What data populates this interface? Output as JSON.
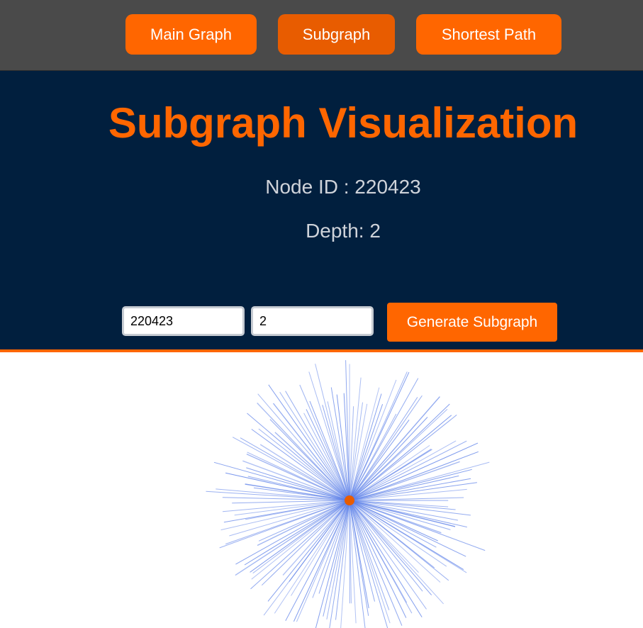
{
  "nav": {
    "main_label": "Main Graph",
    "subgraph_label": "Subgraph",
    "shortest_path_label": "Shortest Path"
  },
  "header": {
    "title": "Subgraph Visualization",
    "node_id_text": "Node ID : 220423",
    "depth_text": "Depth: 2"
  },
  "form": {
    "node_id_value": "220423",
    "depth_value": "2",
    "generate_label": "Generate Subgraph"
  },
  "graph": {
    "center_node_id": "220423",
    "edge_count": 150,
    "colors": {
      "edge": "#5b7fe8",
      "center_node": "#e85c00",
      "accent": "#ff6600",
      "header_bg": "#011f3e",
      "nav_bg": "#4a4a4a"
    }
  }
}
